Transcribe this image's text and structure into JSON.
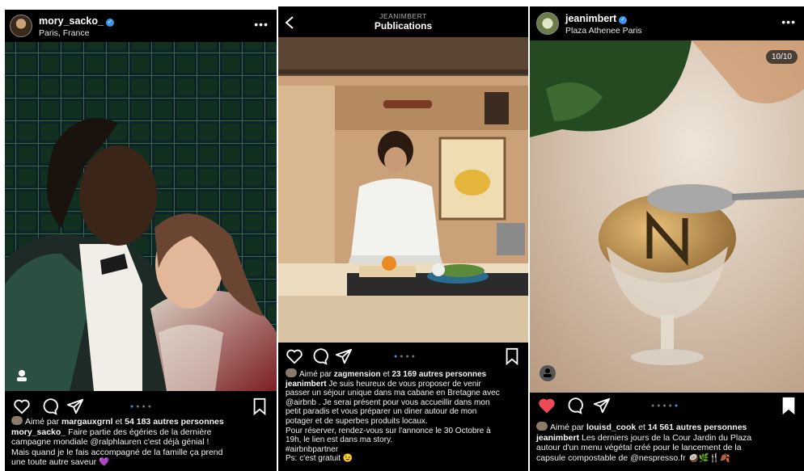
{
  "post1": {
    "username": "mory_sacko_",
    "location": "Paris, France",
    "liked_prefix": "Aimé par",
    "liked_user": "margauxgrnl",
    "liked_connector": "et",
    "liked_count": "54 183 autres personnes",
    "caption_user": "mory_sacko_",
    "caption_lines": [
      "Faire partie des égéries de la dernière",
      "campagne mondiale @ralphlauren c'est déjà génial !",
      "Mais quand je le fais accompagné de la famille ça prend",
      "une toute autre saveur 💜"
    ]
  },
  "post2": {
    "header_user": "JEANIMBERT",
    "header_title": "Publications",
    "liked_prefix": "Aimé par",
    "liked_user": "zagmension",
    "liked_connector": "et",
    "liked_count": "23 169 autres personnes",
    "caption_user": "jeanimbert",
    "caption_lines": [
      "Je suis heureux de vous proposer de venir",
      "passer un séjour unique dans ma cabane en Bretagne avec",
      "@airbnb . Je serai présent pour vous accueillir dans mon",
      "petit paradis et vous préparer un diner autour de mon",
      "potager et de superbes produits locaux.",
      "Pour réserver, rendez-vous sur l'annonce le 30 Octobre à",
      "19h, le lien est dans ma story.",
      "#airbnbpartner",
      "Ps: c'est gratuit 😉"
    ]
  },
  "post3": {
    "username": "jeanimbert",
    "location": "Plaza Athenee Paris",
    "counter": "10/10",
    "liked_prefix": "Aimé par",
    "liked_user": "louisd_cook",
    "liked_connector": "et",
    "liked_count": "14 561 autres personnes",
    "caption_user": "jeanimbert",
    "caption_lines": [
      "Les derniers jours de la Cour Jardin du Plaza",
      "autour d'un menu végétal créé pour le lancement de la",
      "capsule compostable de @nespresso.fr 🥥🌿🍴🍂"
    ]
  },
  "colors": {
    "background": "#000000",
    "accent": "#3897f0",
    "like_red": "#ed4956"
  }
}
